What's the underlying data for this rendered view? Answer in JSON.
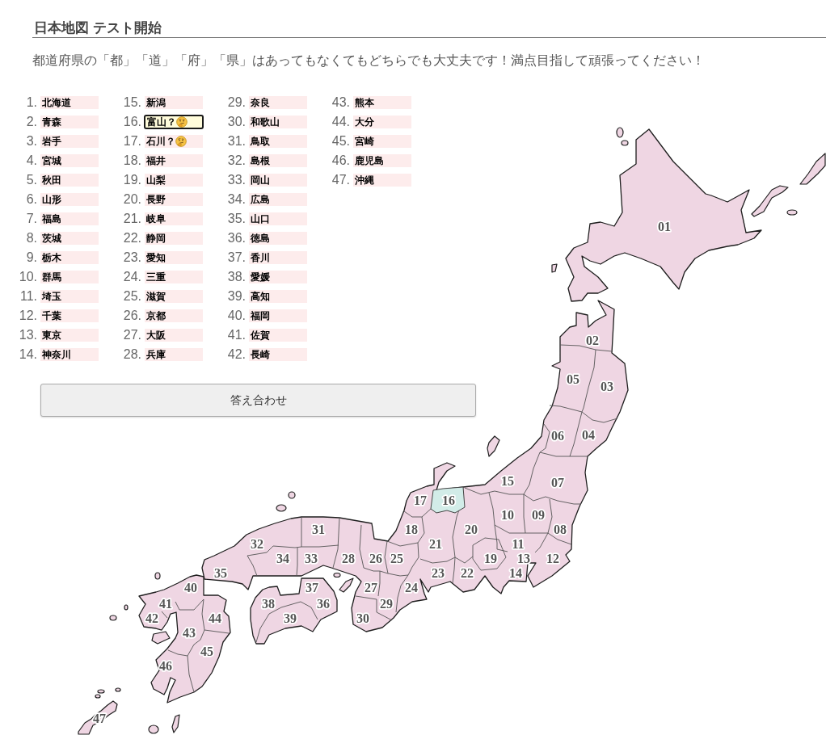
{
  "title": "日本地図 テスト開始",
  "instructions": "都道府県の「都」「道」「府」「県」はあってもなくてもどちらでも大丈夫です！満点目指して頑張ってください！",
  "prefectures": [
    {
      "number": "1.",
      "answer": "北海道",
      "selected": false,
      "unsure": false
    },
    {
      "number": "2.",
      "answer": "青森",
      "selected": false,
      "unsure": false
    },
    {
      "number": "3.",
      "answer": "岩手",
      "selected": false,
      "unsure": false
    },
    {
      "number": "4.",
      "answer": "宮城",
      "selected": false,
      "unsure": false
    },
    {
      "number": "5.",
      "answer": "秋田",
      "selected": false,
      "unsure": false
    },
    {
      "number": "6.",
      "answer": "山形",
      "selected": false,
      "unsure": false
    },
    {
      "number": "7.",
      "answer": "福島",
      "selected": false,
      "unsure": false
    },
    {
      "number": "8.",
      "answer": "茨城",
      "selected": false,
      "unsure": false
    },
    {
      "number": "9.",
      "answer": "栃木",
      "selected": false,
      "unsure": false
    },
    {
      "number": "10.",
      "answer": "群馬",
      "selected": false,
      "unsure": false
    },
    {
      "number": "11.",
      "answer": "埼玉",
      "selected": false,
      "unsure": false
    },
    {
      "number": "12.",
      "answer": "千葉",
      "selected": false,
      "unsure": false
    },
    {
      "number": "13.",
      "answer": "東京",
      "selected": false,
      "unsure": false
    },
    {
      "number": "14.",
      "answer": "神奈川",
      "selected": false,
      "unsure": false
    },
    {
      "number": "15.",
      "answer": "新潟",
      "selected": false,
      "unsure": false
    },
    {
      "number": "16.",
      "answer": "富山？",
      "selected": true,
      "unsure": true
    },
    {
      "number": "17.",
      "answer": "石川？",
      "selected": false,
      "unsure": true
    },
    {
      "number": "18.",
      "answer": "福井",
      "selected": false,
      "unsure": false
    },
    {
      "number": "19.",
      "answer": "山梨",
      "selected": false,
      "unsure": false
    },
    {
      "number": "20.",
      "answer": "長野",
      "selected": false,
      "unsure": false
    },
    {
      "number": "21.",
      "answer": "岐阜",
      "selected": false,
      "unsure": false
    },
    {
      "number": "22.",
      "answer": "静岡",
      "selected": false,
      "unsure": false
    },
    {
      "number": "23.",
      "answer": "愛知",
      "selected": false,
      "unsure": false
    },
    {
      "number": "24.",
      "answer": "三重",
      "selected": false,
      "unsure": false
    },
    {
      "number": "25.",
      "answer": "滋賀",
      "selected": false,
      "unsure": false
    },
    {
      "number": "26.",
      "answer": "京都",
      "selected": false,
      "unsure": false
    },
    {
      "number": "27.",
      "answer": "大阪",
      "selected": false,
      "unsure": false
    },
    {
      "number": "28.",
      "answer": "兵庫",
      "selected": false,
      "unsure": false
    },
    {
      "number": "29.",
      "answer": "奈良",
      "selected": false,
      "unsure": false
    },
    {
      "number": "30.",
      "answer": "和歌山",
      "selected": false,
      "unsure": false
    },
    {
      "number": "31.",
      "answer": "鳥取",
      "selected": false,
      "unsure": false
    },
    {
      "number": "32.",
      "answer": "島根",
      "selected": false,
      "unsure": false
    },
    {
      "number": "33.",
      "answer": "岡山",
      "selected": false,
      "unsure": false
    },
    {
      "number": "34.",
      "answer": "広島",
      "selected": false,
      "unsure": false
    },
    {
      "number": "35.",
      "answer": "山口",
      "selected": false,
      "unsure": false
    },
    {
      "number": "36.",
      "answer": "徳島",
      "selected": false,
      "unsure": false
    },
    {
      "number": "37.",
      "answer": "香川",
      "selected": false,
      "unsure": false
    },
    {
      "number": "38.",
      "answer": "愛媛",
      "selected": false,
      "unsure": false
    },
    {
      "number": "39.",
      "answer": "高知",
      "selected": false,
      "unsure": false
    },
    {
      "number": "40.",
      "answer": "福岡",
      "selected": false,
      "unsure": false
    },
    {
      "number": "41.",
      "answer": "佐賀",
      "selected": false,
      "unsure": false
    },
    {
      "number": "42.",
      "answer": "長崎",
      "selected": false,
      "unsure": false
    },
    {
      "number": "43.",
      "answer": "熊本",
      "selected": false,
      "unsure": false
    },
    {
      "number": "44.",
      "answer": "大分",
      "selected": false,
      "unsure": false
    },
    {
      "number": "45.",
      "answer": "宮崎",
      "selected": false,
      "unsure": false
    },
    {
      "number": "46.",
      "answer": "鹿児島",
      "selected": false,
      "unsure": false
    },
    {
      "number": "47.",
      "answer": "沖縄",
      "selected": false,
      "unsure": false
    }
  ],
  "check_button": "答え合わせ",
  "map": {
    "labels": [
      "01",
      "02",
      "05",
      "03",
      "06",
      "04",
      "15",
      "07",
      "17",
      "16",
      "10",
      "09",
      "31",
      "18",
      "20",
      "08",
      "32",
      "21",
      "11",
      "34",
      "33",
      "28",
      "26",
      "25",
      "19",
      "13",
      "12",
      "35",
      "23",
      "22",
      "14",
      "40",
      "37",
      "27",
      "24",
      "41",
      "38",
      "36",
      "29",
      "42",
      "44",
      "39",
      "30",
      "43",
      "45",
      "46",
      "47"
    ]
  }
}
